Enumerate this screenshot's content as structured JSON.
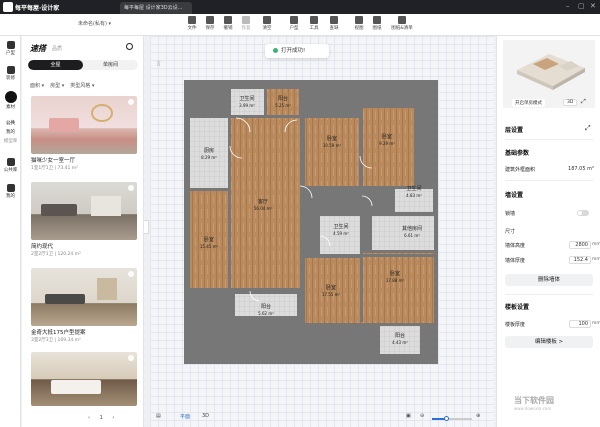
{
  "app": {
    "name": "每平每屋·设计家",
    "tab_title": "每平每屋 设计家3D云设..."
  },
  "toolbar": {
    "project": "未命名(私有)",
    "tools": [
      "文件",
      "保存",
      "撤销",
      "恢复",
      "清空",
      "户型",
      "工具",
      "查缺",
      "视图",
      "图纸",
      "图纸&清单"
    ]
  },
  "rail": {
    "items": [
      "户型",
      "装修",
      "素材",
      "公共",
      "我的",
      "模型库",
      "公共库",
      "我的"
    ]
  },
  "panel": {
    "title": "速搭",
    "subtitle": "品质",
    "tabs": [
      "全屋",
      "单房间"
    ],
    "filters": [
      "面积",
      "房型",
      "类型风格"
    ],
    "cards": [
      {
        "title": "猫咪少女一室一厅",
        "sub": "1室1厅1卫 | 73.41 m²"
      },
      {
        "title": "简约现代",
        "sub": "2室2厅1卫 | 120.24 m²"
      },
      {
        "title": "金奇大抵175户型提案",
        "sub": "3室2厅3卫 | 169.34 m²"
      },
      {
        "title": "",
        "sub": ""
      }
    ],
    "pager": "1"
  },
  "toast": {
    "text": "打开成功!"
  },
  "bottombar": {
    "view_2d": "平面",
    "view_3d": "3D"
  },
  "floorplan": {
    "rooms": [
      {
        "name": "卫生间",
        "area": "3.99 m²"
      },
      {
        "name": "阳台",
        "area": "5.25 m²"
      },
      {
        "name": "厨房",
        "area": "8.29 m²"
      },
      {
        "name": "客厅",
        "area": "56.04 m²"
      },
      {
        "name": "卧室",
        "area": "10.59 m²"
      },
      {
        "name": "卧室",
        "area": "9.29 m²"
      },
      {
        "name": "卫生间",
        "area": "4.83 m²"
      },
      {
        "name": "卧室",
        "area": "15.45 m²"
      },
      {
        "name": "卫生间",
        "area": "4.59 m²"
      },
      {
        "name": "其他房间",
        "area": "6.61 m²"
      },
      {
        "name": "阳台",
        "area": "5.62 m²"
      },
      {
        "name": "卧室",
        "area": "17.55 m²"
      },
      {
        "name": "卧室",
        "area": "17.88 m²"
      },
      {
        "name": "阳台",
        "area": "4.43 m²"
      }
    ]
  },
  "right": {
    "preview_btn": "开启单房模式",
    "view3d": "3D",
    "section_floor": "层设置",
    "basic": "基础参数",
    "area_label": "建筑外框面积",
    "area_value": "187.05 m²",
    "wall": "墙设置",
    "lock_label": "锁墙",
    "size": "尺寸",
    "wall_height_label": "墙体高度",
    "wall_height": "2800",
    "wall_thick_label": "墙体厚度",
    "wall_thick": "152.4",
    "unit_mm": "mm",
    "delete_wall": "删除墙体",
    "slab": "楼板设置",
    "slab_thick_label": "楼板厚度",
    "slab_thick": "100",
    "edit_slab": "编辑楼板 >"
  },
  "watermark": {
    "main": "当下软件园",
    "sub": "www.downxia.com"
  }
}
